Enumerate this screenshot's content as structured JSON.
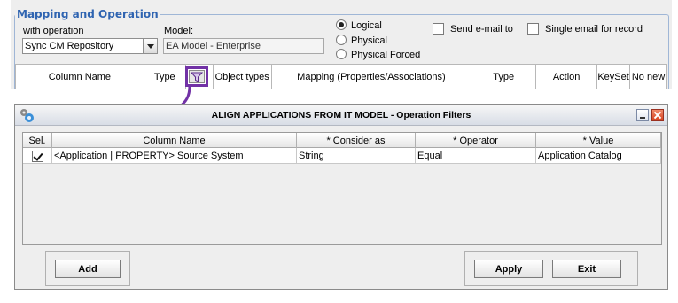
{
  "mapping": {
    "title": "Mapping and Operation",
    "operation_label": "with operation",
    "operation_value": "Sync CM Repository",
    "model_label": "Model:",
    "model_value": "EA Model - Enterprise",
    "radios": [
      "Logical",
      "Physical",
      "Physical Forced"
    ],
    "radio_selected": "Logical",
    "send_email_label": "Send e-mail to",
    "single_email_label": "Single email for record",
    "columns": [
      "Column Name",
      "Type",
      "",
      "Object types",
      "Mapping (Properties/Associations)",
      "Type",
      "Action",
      "KeySet",
      "No new"
    ]
  },
  "highlight_color": "#7232a6",
  "dialog": {
    "title": "ALIGN APPLICATIONS FROM IT MODEL - Operation Filters",
    "columns": [
      "Sel.",
      "Column Name",
      "* Consider as",
      "* Operator",
      "* Value"
    ],
    "rows": [
      {
        "selected": true,
        "column_name": "<Application | PROPERTY> Source System",
        "consider_as": "String",
        "operator": "Equal",
        "value": "Application Catalog"
      }
    ],
    "add_label": "Add",
    "apply_label": "Apply",
    "exit_label": "Exit"
  }
}
